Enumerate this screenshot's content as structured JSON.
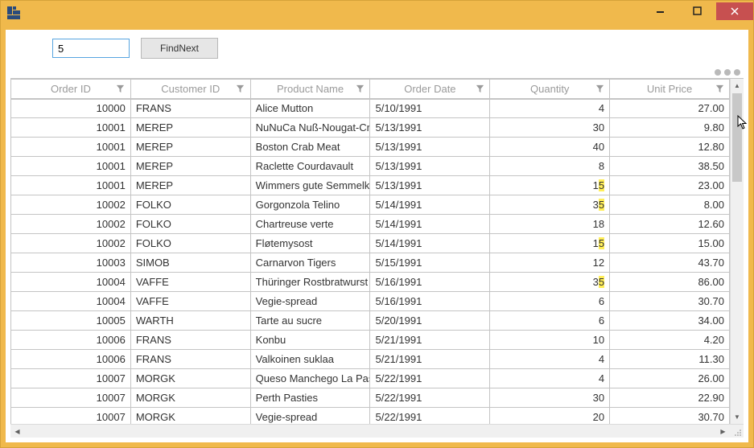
{
  "window": {
    "title": ""
  },
  "toolbar": {
    "search_value": "5",
    "findnext_label": "FindNext"
  },
  "grid": {
    "columns": [
      {
        "key": "orderid",
        "label": "Order ID",
        "cls": "col-orderid"
      },
      {
        "key": "custid",
        "label": "Customer ID",
        "cls": "col-custid"
      },
      {
        "key": "product",
        "label": "Product Name",
        "cls": "col-product"
      },
      {
        "key": "orderdate",
        "label": "Order Date",
        "cls": "col-orderdate"
      },
      {
        "key": "qty",
        "label": "Quantity",
        "cls": "col-qty"
      },
      {
        "key": "price",
        "label": "Unit Price",
        "cls": "col-price"
      }
    ],
    "rows": [
      {
        "orderid": "10000",
        "custid": "FRANS",
        "product": "Alice Mutton",
        "orderdate": "5/10/1991",
        "qty": "4",
        "qty_hl": false,
        "price": "27.00"
      },
      {
        "orderid": "10001",
        "custid": "MEREP",
        "product": "NuNuCa Nuß-Nougat-Crem",
        "orderdate": "5/13/1991",
        "qty": "30",
        "qty_hl": false,
        "price": "9.80"
      },
      {
        "orderid": "10001",
        "custid": "MEREP",
        "product": "Boston Crab Meat",
        "orderdate": "5/13/1991",
        "qty": "40",
        "qty_hl": false,
        "price": "12.80"
      },
      {
        "orderid": "10001",
        "custid": "MEREP",
        "product": "Raclette Courdavault",
        "orderdate": "5/13/1991",
        "qty": "8",
        "qty_hl": false,
        "price": "38.50"
      },
      {
        "orderid": "10001",
        "custid": "MEREP",
        "product": "Wimmers gute Semmelknöd",
        "orderdate": "5/13/1991",
        "qty": "15",
        "qty_hl": true,
        "price": "23.00"
      },
      {
        "orderid": "10002",
        "custid": "FOLKO",
        "product": "Gorgonzola Telino",
        "orderdate": "5/14/1991",
        "qty": "35",
        "qty_hl": true,
        "price": "8.00"
      },
      {
        "orderid": "10002",
        "custid": "FOLKO",
        "product": "Chartreuse verte",
        "orderdate": "5/14/1991",
        "qty": "18",
        "qty_hl": false,
        "price": "12.60"
      },
      {
        "orderid": "10002",
        "custid": "FOLKO",
        "product": "Fløtemysost",
        "orderdate": "5/14/1991",
        "qty": "15",
        "qty_hl": true,
        "price": "15.00"
      },
      {
        "orderid": "10003",
        "custid": "SIMOB",
        "product": "Carnarvon Tigers",
        "orderdate": "5/15/1991",
        "qty": "12",
        "qty_hl": false,
        "price": "43.70"
      },
      {
        "orderid": "10004",
        "custid": "VAFFE",
        "product": "Thüringer Rostbratwurst",
        "orderdate": "5/16/1991",
        "qty": "35",
        "qty_hl": true,
        "price": "86.00"
      },
      {
        "orderid": "10004",
        "custid": "VAFFE",
        "product": "Vegie-spread",
        "orderdate": "5/16/1991",
        "qty": "6",
        "qty_hl": false,
        "price": "30.70"
      },
      {
        "orderid": "10005",
        "custid": "WARTH",
        "product": "Tarte au sucre",
        "orderdate": "5/20/1991",
        "qty": "6",
        "qty_hl": false,
        "price": "34.00"
      },
      {
        "orderid": "10006",
        "custid": "FRANS",
        "product": "Konbu",
        "orderdate": "5/21/1991",
        "qty": "10",
        "qty_hl": false,
        "price": "4.20"
      },
      {
        "orderid": "10006",
        "custid": "FRANS",
        "product": "Valkoinen suklaa",
        "orderdate": "5/21/1991",
        "qty": "4",
        "qty_hl": false,
        "price": "11.30"
      },
      {
        "orderid": "10007",
        "custid": "MORGK",
        "product": "Queso Manchego La Pastor",
        "orderdate": "5/22/1991",
        "qty": "4",
        "qty_hl": false,
        "price": "26.00"
      },
      {
        "orderid": "10007",
        "custid": "MORGK",
        "product": "Perth Pasties",
        "orderdate": "5/22/1991",
        "qty": "30",
        "qty_hl": false,
        "price": "22.90"
      },
      {
        "orderid": "10007",
        "custid": "MORGK",
        "product": "Vegie-spread",
        "orderdate": "5/22/1991",
        "qty": "20",
        "qty_hl": false,
        "price": "30.70"
      }
    ]
  },
  "search_term": "5"
}
